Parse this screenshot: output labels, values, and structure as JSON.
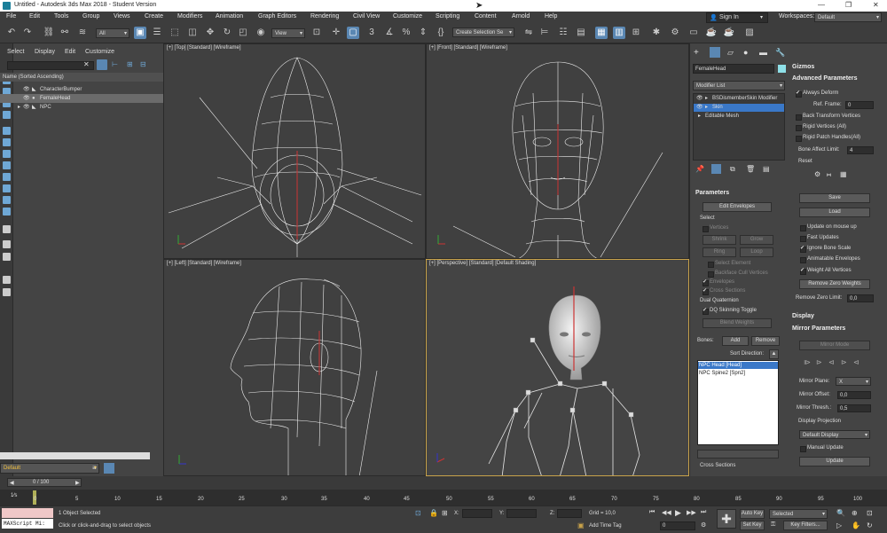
{
  "window": {
    "title": "Untitled - Autodesk 3ds Max 2018 - Student Version"
  },
  "menu": [
    "File",
    "Edit",
    "Tools",
    "Group",
    "Views",
    "Create",
    "Modifiers",
    "Animation",
    "Graph Editors",
    "Rendering",
    "Civil View",
    "Customize",
    "Scripting",
    "Content",
    "Arnold",
    "Help"
  ],
  "signin": {
    "label": "Sign In"
  },
  "workspaces": {
    "label": "Workspaces:",
    "value": "Default"
  },
  "toolbar": {
    "filter": "All",
    "view": "View",
    "selection_set": "Create Selection Se"
  },
  "explorer": {
    "tabs": [
      "Select",
      "Display",
      "Edit",
      "Customize"
    ],
    "header": "Name (Sorted Ascending)",
    "items": [
      {
        "name": "CharacterBumper"
      },
      {
        "name": "FemaleHead"
      },
      {
        "name": "NPC"
      }
    ],
    "layer": "Default"
  },
  "viewports": {
    "top": "[+] [Top] [Standard] [Wireframe]",
    "front": "[+] [Front] [Standard] [Wireframe]",
    "left": "[+] [Left] [Standard] [Wireframe]",
    "perspective": "[+] [Perspective] [Standard] [Default Shading]"
  },
  "command_panel": {
    "object_name": "FemaleHead",
    "modifier_list": "Modifier List",
    "stack": [
      "BSDismemberSkin Modifier",
      "Skin",
      "Editable Mesh"
    ],
    "parameters": {
      "title": "Parameters",
      "edit_envelopes": "Edit Envelopes",
      "select_label": "Select",
      "vertices": "Vertices",
      "shrink": "Shrink",
      "grow": "Grow",
      "ring": "Ring",
      "loop": "Loop",
      "select_element": "Select Element",
      "backface": "Backface Cull Vertices",
      "envelopes": "Envelopes",
      "cross_sections": "Cross Sections",
      "dual_quaternion": "Dual Quaternion",
      "dq_toggle": "DQ Skinning Toggle",
      "blend_weights": "Blend Weights",
      "bones_label": "Bones:",
      "add": "Add",
      "remove": "Remove",
      "sort_direction": "Sort Direction:",
      "bones": [
        "NPC Head [Head]",
        "NPC Spine2 [Spn2]"
      ],
      "cross_sections_footer": "Cross Sections"
    }
  },
  "rollout": {
    "gizmos": "Gizmos",
    "advanced": "Advanced Parameters",
    "always_deform": "Always Deform",
    "ref_frame_label": "Ref. Frame:",
    "ref_frame": "0",
    "back_transform": "Back Transform Vertices",
    "rigid_vertices": "Rigid Vertices (All)",
    "rigid_patch": "Rigid Patch Handles(All)",
    "bone_affect_label": "Bone Affect Limit:",
    "bone_affect": "4",
    "reset": "Reset",
    "save": "Save",
    "load": "Load",
    "update_mouse": "Update on mouse up",
    "fast_updates": "Fast Updates",
    "ignore_scale": "Ignore Bone Scale",
    "animatable_env": "Animatable Envelopes",
    "weight_all": "Weight All Vertices",
    "remove_zero": "Remove Zero Weights",
    "remove_zero_limit_label": "Remove Zero Limit:",
    "remove_zero_limit": "0,0",
    "display": "Display",
    "mirror": "Mirror Parameters",
    "mirror_mode": "Mirror Mode",
    "mirror_plane_label": "Mirror Plane:",
    "mirror_plane": "X",
    "mirror_offset_label": "Mirror Offset:",
    "mirror_offset": "0,0",
    "mirror_thresh_label": "Mirror Thresh.:",
    "mirror_thresh": "0,5",
    "display_projection": "Display Projection",
    "default_display": "Default Display",
    "manual_update": "Manual Update",
    "update": "Update"
  },
  "timeline": {
    "frame": "0 / 100",
    "ticks": [
      "0",
      "5",
      "10",
      "15",
      "20",
      "25",
      "30",
      "35",
      "40",
      "45",
      "50",
      "55",
      "60",
      "65",
      "70",
      "75",
      "80",
      "85",
      "90",
      "95",
      "100"
    ],
    "fps": "1⁄s"
  },
  "status": {
    "maxscript": "MAXScript Mi:",
    "selected": "1 Object Selected",
    "prompt": "Click or click-and-drag to select objects",
    "x_label": "X:",
    "y_label": "Y:",
    "z_label": "Z:",
    "grid": "Grid = 10,0",
    "add_time_tag": "Add Time Tag",
    "auto_key": "Auto Key",
    "set_key": "Set Key",
    "selected_dd": "Selected",
    "key_filters": "Key Filters...",
    "frame": "0"
  },
  "colors": {
    "accent": "#5a87b3",
    "viewport_bg": "#404040",
    "active_border": "#c8a24a",
    "selection": "#3a78c8"
  }
}
